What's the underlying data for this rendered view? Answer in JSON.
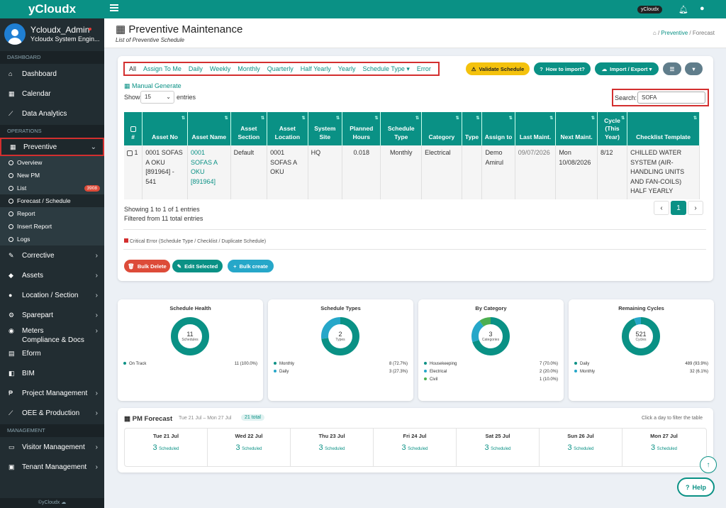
{
  "brand": "yCloudx",
  "user": {
    "name": "Ycloudx_Admin",
    "role": "Ycloudx System Engin..."
  },
  "sidebar": {
    "sections": [
      "DASHBOARD",
      "OPERATIONS",
      "MANAGEMENT"
    ],
    "dashboard": [
      {
        "icon": "home-icon",
        "label": "Dashboard"
      },
      {
        "icon": "calendar-icon",
        "label": "Calendar"
      },
      {
        "icon": "chart-icon",
        "label": "Data Analytics"
      }
    ],
    "preventive": {
      "label": "Preventive",
      "subs": [
        {
          "label": "Overview"
        },
        {
          "label": "New PM"
        },
        {
          "label": "List",
          "badge": "3908"
        },
        {
          "label": "Forecast / Schedule"
        },
        {
          "label": "Report"
        },
        {
          "label": "Insert Report"
        },
        {
          "label": "Logs"
        }
      ]
    },
    "ops": [
      {
        "label": "Corrective"
      },
      {
        "label": "Assets"
      },
      {
        "label": "Location / Section"
      },
      {
        "label": "Sparepart"
      },
      {
        "label": "Meters"
      },
      {
        "label": "Compliance & Docs"
      },
      {
        "label": "Eform"
      },
      {
        "label": "BIM"
      },
      {
        "label": "Project Management"
      },
      {
        "label": "OEE & Production"
      }
    ],
    "mgmt": [
      {
        "label": "Visitor Management"
      },
      {
        "label": "Tenant Management"
      }
    ],
    "footer": "©yCloudx"
  },
  "topbar": {
    "badge": "yCloudx"
  },
  "page": {
    "title": "Preventive Maintenance",
    "subtitle": "List of Preventive Schedule",
    "crumb_mid": "Preventive",
    "crumb_end": "Forecast"
  },
  "tabs": [
    "All",
    "Assign To Me",
    "Daily",
    "Weekly",
    "Monthly",
    "Quarterly",
    "Half Yearly",
    "Yearly",
    "Schedule Type ▾",
    "Error"
  ],
  "buttons": {
    "validate": "Validate Schedule",
    "howto": "How to import?",
    "importexport": "Import / Export ▾"
  },
  "manual_generate": "Manual Generate",
  "show_label": "Show",
  "entries_label": "entries",
  "page_size": "15",
  "search": {
    "label": "Search:",
    "value": "SOFA"
  },
  "table": {
    "headers": [
      "#",
      "Asset No",
      "Asset Name",
      "Asset Section",
      "Asset Location",
      "System Site",
      "Planned Hours",
      "Schedule Type",
      "Category",
      "Type",
      "Assign to",
      "Last Maint.",
      "Next Maint.",
      "Cycle (This Year)",
      "Checklist Template"
    ],
    "row": [
      "1",
      "0001 SOFAS A OKU [891964] - 541",
      "0001 SOFAS A OKU [891964]",
      "Default",
      "0001 SOFAS A OKU",
      "HQ",
      "0.018",
      "Monthly",
      "Electrical",
      "",
      "Demo Amirul",
      "09/07/2026",
      "Mon 10/08/2026",
      "8/12",
      "CHILLED WATER SYSTEM (AIR-HANDLING UNITS AND FAN-COILS) HALF YEARLY"
    ]
  },
  "info": {
    "showing": "Showing 1 to 1 of 1 entries",
    "filtered": "Filtered from 11 total entries"
  },
  "pager": {
    "current": "1"
  },
  "legend_note": "Critical Error (Schedule Type / Checklist / Duplicate Schedule)",
  "bulk": {
    "delete": "Bulk Delete",
    "edit": "Edit Selected",
    "create": "Bulk create"
  },
  "colors": {
    "teal": "#0a9185",
    "red": "#dd4b39",
    "yellow": "#f4c20d",
    "green": "#4caf50",
    "blue": "#26a7c9"
  },
  "stats": [
    {
      "title": "Schedule Health",
      "center": "11",
      "unit": "Schedules",
      "slices": [
        {
          "label": "On Track",
          "value": "11 (100.0%)",
          "frac": 1.0,
          "color": "#0a9185"
        }
      ]
    },
    {
      "title": "Schedule Types",
      "center": "2",
      "unit": "Types",
      "slices": [
        {
          "label": "Monthly",
          "value": "8 (72.7%)",
          "frac": 0.727,
          "color": "#0a9185"
        },
        {
          "label": "Daily",
          "value": "3 (27.3%)",
          "frac": 0.273,
          "color": "#26a7c9"
        }
      ]
    },
    {
      "title": "By Category",
      "center": "3",
      "unit": "Categories",
      "slices": [
        {
          "label": "Housekeeping",
          "value": "7 (70.0%)",
          "frac": 0.7,
          "color": "#0a9185"
        },
        {
          "label": "Electrical",
          "value": "2 (20.0%)",
          "frac": 0.2,
          "color": "#26a7c9"
        },
        {
          "label": "Civil",
          "value": "1 (10.0%)",
          "frac": 0.1,
          "color": "#4caf50"
        }
      ]
    },
    {
      "title": "Remaining Cycles",
      "center": "521",
      "unit": "Cycles",
      "slices": [
        {
          "label": "Daily",
          "value": "489 (93.9%)",
          "frac": 0.939,
          "color": "#0a9185"
        },
        {
          "label": "Monthly",
          "value": "32 (6.1%)",
          "frac": 0.061,
          "color": "#26a7c9"
        }
      ]
    }
  ],
  "forecast": {
    "title": "PM Forecast",
    "range": "Tue 21 Jul – Mon 27 Jul",
    "total": "21 total",
    "hint": "Click a day to filter the table",
    "days": [
      {
        "d": "Tue 21 Jul",
        "n": "3"
      },
      {
        "d": "Wed 22 Jul",
        "n": "3"
      },
      {
        "d": "Thu 23 Jul",
        "n": "3"
      },
      {
        "d": "Fri 24 Jul",
        "n": "3"
      },
      {
        "d": "Sat 25 Jul",
        "n": "3"
      },
      {
        "d": "Sun 26 Jul",
        "n": "3"
      },
      {
        "d": "Mon 27 Jul",
        "n": "3"
      }
    ],
    "scheduled": "Scheduled"
  },
  "help": "Help"
}
